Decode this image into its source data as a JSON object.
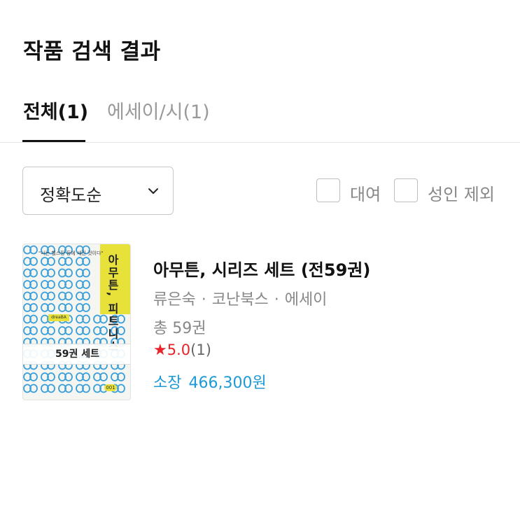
{
  "header": {
    "title": "작품 검색 결과"
  },
  "tabs": [
    {
      "label": "전체(1)",
      "active": true
    },
    {
      "label": "에세이/시(1)",
      "active": false
    }
  ],
  "sort": {
    "selected": "정확도순"
  },
  "filters": [
    {
      "label": "대여",
      "checked": false
    },
    {
      "label": "성인 제외",
      "checked": false
    }
  ],
  "results": [
    {
      "title": "아무튼, 시리즈 세트 (전59권)",
      "author": "류은숙",
      "publisher": "코난북스",
      "category": "에세이",
      "separator": "·",
      "volumes": "총 59권",
      "rating": {
        "score": "5.0",
        "count": "(1)"
      },
      "price": {
        "label": "소장",
        "amount": "466,300원"
      },
      "cover": {
        "label": "59권 세트",
        "title_text": "아무튼, 피트니스",
        "tagline": "\"나는 헬스장 등에 새긴 것이다\"",
        "publisher_mark": "dreaBA",
        "number_badge": "001"
      }
    }
  ],
  "colors": {
    "accent_price": "#1e9ad6",
    "star": "#e8232a",
    "cover_yellow": "#e7e13a",
    "cover_ring_blue": "#3a9fd9"
  }
}
